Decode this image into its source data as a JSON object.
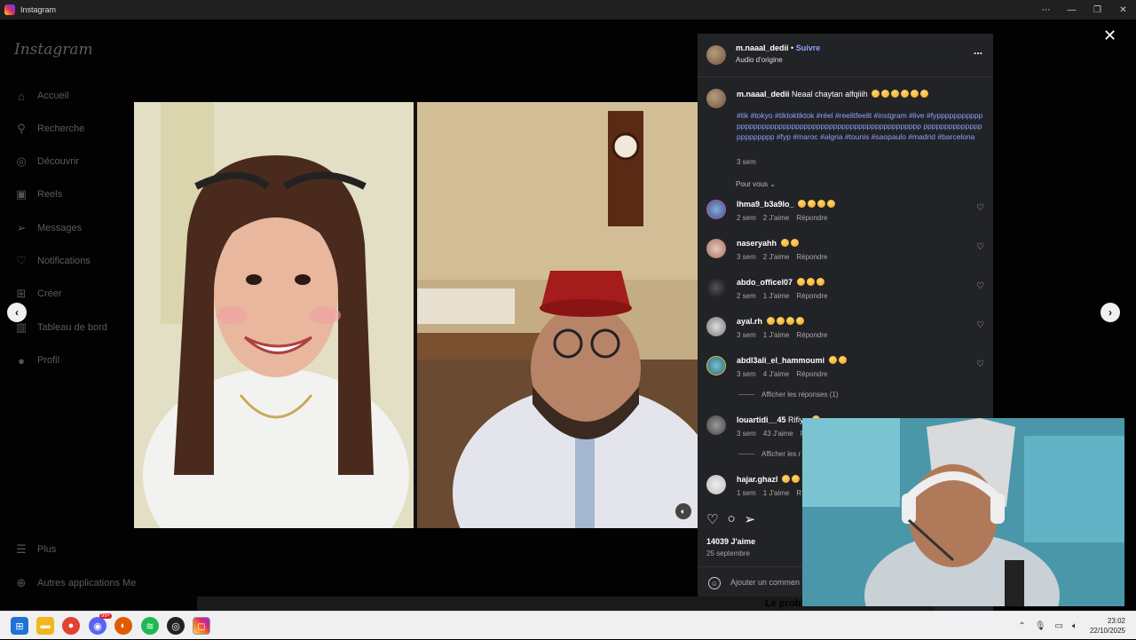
{
  "window": {
    "title": "Instagram",
    "controls": [
      "⋯",
      "—",
      "❐",
      "✕"
    ]
  },
  "sidebar": {
    "logo": "Instagram",
    "items": [
      {
        "label": "Accueil",
        "icon": "home-icon",
        "glyph": "⌂"
      },
      {
        "label": "Recherche",
        "icon": "search-icon",
        "glyph": "⚲"
      },
      {
        "label": "Découvrir",
        "icon": "compass-icon",
        "glyph": "◎"
      },
      {
        "label": "Reels",
        "icon": "reels-icon",
        "glyph": "▣"
      },
      {
        "label": "Messages",
        "icon": "messages-icon",
        "glyph": "➢"
      },
      {
        "label": "Notifications",
        "icon": "heart-icon",
        "glyph": "♡"
      },
      {
        "label": "Créer",
        "icon": "create-icon",
        "glyph": "⊞"
      },
      {
        "label": "Tableau de bord",
        "icon": "dashboard-icon",
        "glyph": "▥"
      },
      {
        "label": "Profil",
        "icon": "profile-icon",
        "glyph": "●"
      }
    ],
    "more": "Plus",
    "other_apps": "Autres applications Me"
  },
  "post": {
    "author": "m.naaal_dedii",
    "separator": "•",
    "follow": "Suivre",
    "audio": "Audio d'origine",
    "menu": "...",
    "caption_text": "Neaal chaytan alfqiiih",
    "hashtags": "#tik #tokyo #tiktoktiktok #réel #reelitfeelit #instgram #live #fyppppppppppppppppppppppppppppppppppppppppppppppppppppppp ppppppppppppppppppppppp #fyp #maroc #algria #tounis #saopaulo #madrid #barcelona",
    "caption_age": "3 sem",
    "sort_label": "Pour vous",
    "likes": "14039 J'aime",
    "date": "25 septembre",
    "add_comment_placeholder": "Ajouter un commen"
  },
  "comments": [
    {
      "user": "lhma9_b3a9lo_",
      "emojis": 4,
      "age": "2 sem",
      "likes": "2 J'aime",
      "reply": "Répondre"
    },
    {
      "user": "naseryahh",
      "emojis": 2,
      "age": "3 sem",
      "likes": "2 J'aime",
      "reply": "Répondre"
    },
    {
      "user": "abdo_officel07",
      "emojis": 3,
      "age": "2 sem",
      "likes": "1 J'aime",
      "reply": "Répondre"
    },
    {
      "user": "ayal.rh",
      "emojis": 4,
      "age": "3 sem",
      "likes": "1 J'aime",
      "reply": "Répondre"
    },
    {
      "user": "abdl3ali_el_hammoumi",
      "emojis": 2,
      "age": "3 sem",
      "likes": "4 J'aime",
      "reply": "Répondre",
      "replies": "Afficher les réponses (1)"
    },
    {
      "user": "louartidi__45",
      "text": "Rifiya",
      "emojis": 1,
      "age": "3 sem",
      "likes": "43 J'aime",
      "reply": "R",
      "replies": "Afficher les r"
    },
    {
      "user": "hajar.ghazl",
      "emojis": 2,
      "age": "1 sem",
      "likes": "1 J'aime",
      "reply": "R"
    }
  ],
  "bottom_caption": "Le problème c'est de les trouver",
  "taskbar": {
    "time": "23:02",
    "date": "22/10/2025",
    "badge": "99+"
  },
  "colors": {
    "link": "#8ea2ff",
    "panel": "#222326",
    "accent_red": "#d62976"
  }
}
